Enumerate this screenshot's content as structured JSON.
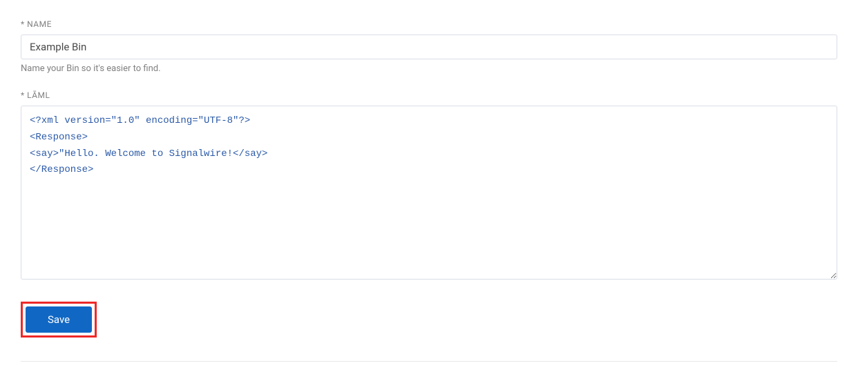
{
  "name_field": {
    "label": "* NAME",
    "value": "Example Bin",
    "help": "Name your Bin so it's easier to find."
  },
  "laml_field": {
    "label": "* LĀML",
    "value": "<?xml version=\"1.0\" encoding=\"UTF-8\"?>\n<Response>\n<say>\"Hello. Welcome to Signalwire!</say>\n</Response>"
  },
  "actions": {
    "save_label": "Save"
  }
}
